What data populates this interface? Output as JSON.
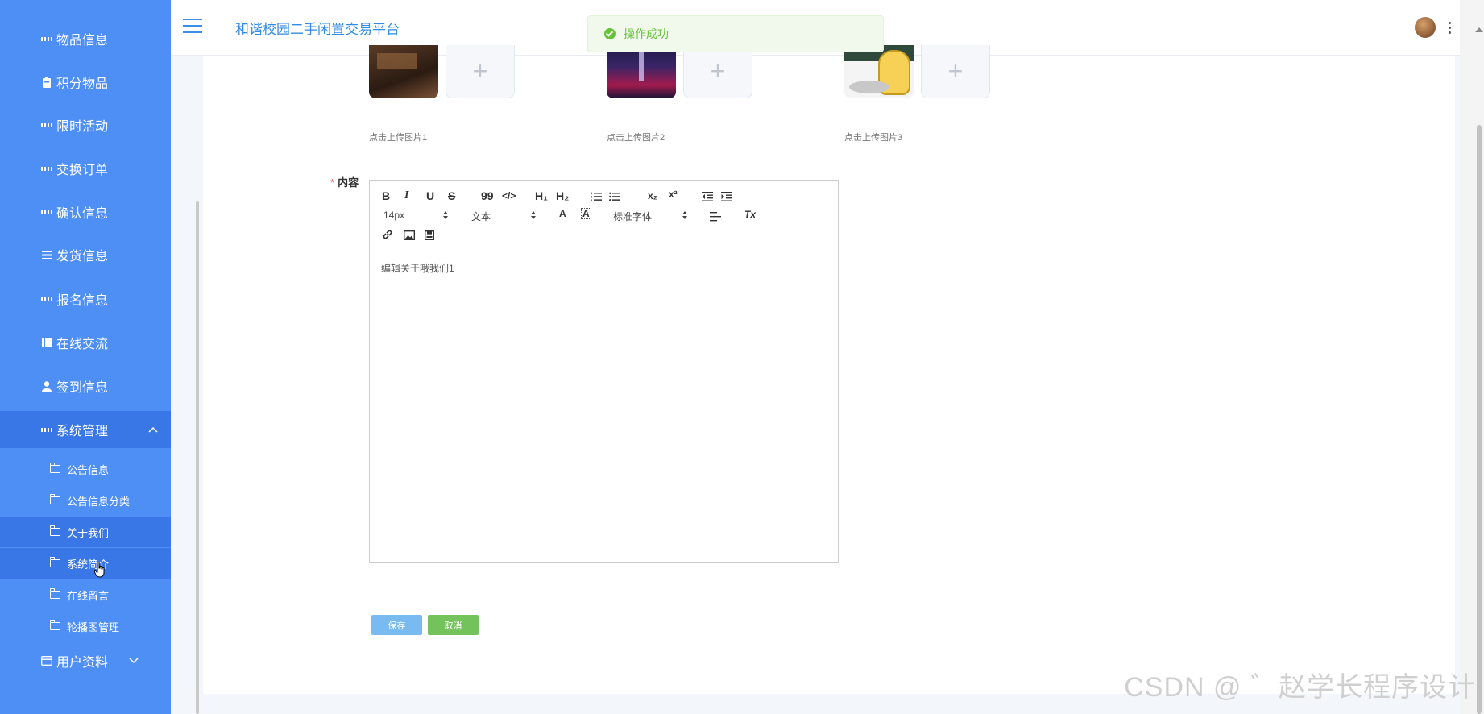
{
  "app": {
    "title": "和谐校园二手闲置交易平台"
  },
  "toast": {
    "message": "操作成功",
    "status_color": "#67c23a"
  },
  "sidebar": {
    "items": [
      {
        "label": "物品信息",
        "icon": "grid-icon"
      },
      {
        "label": "积分物品",
        "icon": "clipboard-icon"
      },
      {
        "label": "限时活动",
        "icon": "grid-icon"
      },
      {
        "label": "交换订单",
        "icon": "grid-icon"
      },
      {
        "label": "确认信息",
        "icon": "grid-icon"
      },
      {
        "label": "发货信息",
        "icon": "list-icon"
      },
      {
        "label": "报名信息",
        "icon": "grid-icon"
      },
      {
        "label": "在线交流",
        "icon": "book-icon"
      },
      {
        "label": "签到信息",
        "icon": "user-icon"
      },
      {
        "label": "系统管理",
        "icon": "grid-icon",
        "expanded": true
      },
      {
        "label": "用户资料",
        "icon": "card-icon",
        "expanded": false
      }
    ],
    "sub_items": [
      {
        "label": "公告信息"
      },
      {
        "label": "公告信息分类"
      },
      {
        "label": "关于我们"
      },
      {
        "label": "系统简介"
      },
      {
        "label": "在线留言"
      },
      {
        "label": "轮播图管理"
      }
    ],
    "accent": "#4d8ff5"
  },
  "uploads": [
    {
      "label": "点击上传图片1"
    },
    {
      "label": "点击上传图片2"
    },
    {
      "label": "点击上传图片3"
    }
  ],
  "form": {
    "content_label": "内容",
    "required_mark": "*"
  },
  "editor": {
    "font_size": "14px",
    "block_type": "文本",
    "font_family": "标准字体",
    "content": "编辑关于哦我们1",
    "toolbar": {
      "bold": "B",
      "italic": "I",
      "underline": "U",
      "strike": "S",
      "quote": "99",
      "code": "</>",
      "h1": "H₁",
      "h2": "H₂",
      "sub": "x₂",
      "sup": "x²",
      "font_color": "A",
      "bg_color": "A",
      "clean": "Tx"
    }
  },
  "actions": {
    "save": "保存",
    "cancel": "取消"
  },
  "watermark": "CSDN @ ゛赵学长程序设计"
}
